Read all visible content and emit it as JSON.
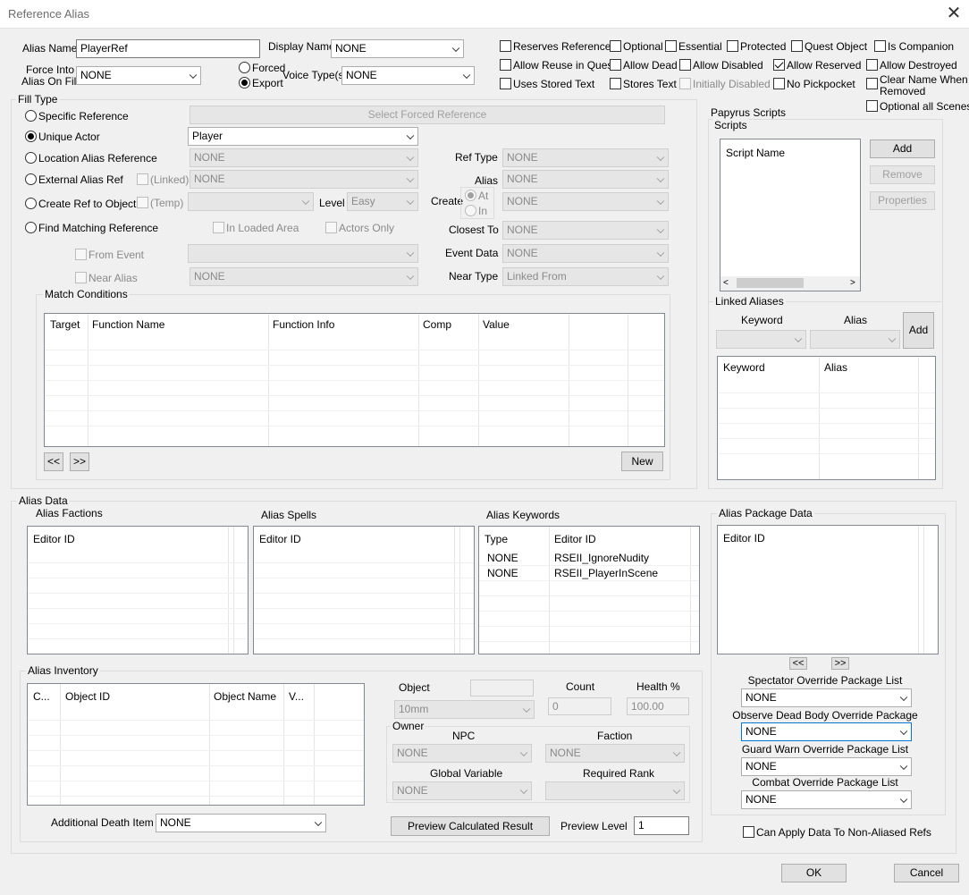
{
  "window": {
    "title": "Reference Alias"
  },
  "top": {
    "alias_name_label": "Alias Name",
    "alias_name_value": "PlayerRef",
    "display_name_label": "Display Name",
    "display_name_value": "NONE",
    "force_into_label_1": "Force Into",
    "force_into_label_2": "Alias On Fill",
    "force_into_value": "NONE",
    "forced_label": "Forced",
    "export_label": "Export",
    "voice_types_label": "Voice Type(s)",
    "voice_types_value": "NONE"
  },
  "flags": {
    "reserves_reference": "Reserves Reference",
    "optional": "Optional",
    "essential": "Essential",
    "protected": "Protected",
    "quest_object": "Quest Object",
    "is_companion": "Is Companion",
    "allow_reuse": "Allow Reuse in Quest",
    "allow_dead": "Allow Dead",
    "allow_disabled": "Allow Disabled",
    "allow_reserved": "Allow Reserved",
    "allow_destroyed": "Allow Destroyed",
    "uses_stored_text": "Uses Stored Text",
    "stores_text": "Stores Text",
    "initially_disabled": "Initially Disabled",
    "no_pickpocket": "No Pickpocket",
    "clear_name_1": "Clear Name When",
    "clear_name_2": "Removed",
    "optional_all_scenes": "Optional all Scenes"
  },
  "fill_type": {
    "group_label": "Fill Type",
    "specific_reference": "Specific Reference",
    "select_forced_reference": "Select Forced Reference",
    "unique_actor": "Unique Actor",
    "unique_actor_value": "Player",
    "location_alias_reference": "Location Alias Reference",
    "location_alias_value": "NONE",
    "ref_type_label": "Ref Type",
    "ref_type_value": "NONE",
    "external_alias_ref": "External Alias Ref",
    "linked_label": "(Linked)",
    "external_alias_value": "NONE",
    "alias_label": "Alias",
    "alias_value": "NONE",
    "create_ref_to_object": "Create Ref to Object",
    "temp_label": "(Temp)",
    "create_ref_value": "",
    "level_label": "Level",
    "level_value": "Easy",
    "create_label": "Create",
    "at_label": "At",
    "in_label": "In",
    "create_value": "NONE",
    "find_matching_reference": "Find Matching Reference",
    "in_loaded_area": "In Loaded Area",
    "actors_only": "Actors Only",
    "closest_to_label": "Closest To",
    "closest_to_value": "NONE",
    "from_event": "From Event",
    "from_event_value": "",
    "event_data_label": "Event Data",
    "event_data_value": "NONE",
    "near_alias": "Near Alias",
    "near_alias_value": "NONE",
    "near_type_label": "Near Type",
    "near_type_value": "Linked From",
    "match_conditions_label": "Match Conditions",
    "columns": [
      "Target",
      "Function Name",
      "Function Info",
      "Comp",
      "Value"
    ],
    "prev_button": "<<",
    "next_button": ">>",
    "new_button": "New"
  },
  "scripts": {
    "group_label": "Papyrus Scripts",
    "sub_label": "Scripts",
    "column": "Script Name",
    "add": "Add",
    "remove": "Remove",
    "properties": "Properties"
  },
  "linked_aliases": {
    "label": "Linked Aliases",
    "keyword_label": "Keyword",
    "alias_label": "Alias",
    "add": "Add",
    "columns": [
      "Keyword",
      "Alias"
    ]
  },
  "alias_data": {
    "label": "Alias Data",
    "factions_label": "Alias Factions",
    "factions_column": "Editor ID",
    "spells_label": "Alias Spells",
    "spells_column": "Editor ID",
    "keywords_label": "Alias Keywords",
    "keywords_columns": [
      "Type",
      "Editor ID"
    ],
    "keywords_rows": [
      {
        "type": "NONE",
        "editor_id": "RSEII_IgnoreNudity"
      },
      {
        "type": "NONE",
        "editor_id": "RSEII_PlayerInScene"
      }
    ],
    "package_label": "Alias Package Data",
    "package_column": "Editor ID",
    "package_prev": "<<",
    "package_next": ">>",
    "spectator_label": "Spectator Override Package List",
    "spectator_value": "NONE",
    "observe_label": "Observe Dead Body Override Package",
    "observe_value": "NONE",
    "guard_label": "Guard Warn Override Package List",
    "guard_value": "NONE",
    "combat_label": "Combat Override Package List",
    "combat_value": "NONE",
    "inventory_label": "Alias Inventory",
    "inventory_columns": [
      "C...",
      "Object ID",
      "Object Name",
      "V..."
    ],
    "object_label": "Object",
    "object_value": "10mm",
    "count_label": "Count",
    "count_value": "0",
    "health_label": "Health %",
    "health_value": "100.00",
    "owner_label": "Owner",
    "npc_label": "NPC",
    "npc_value": "NONE",
    "faction_label": "Faction",
    "faction_value": "NONE",
    "global_var_label": "Global Variable",
    "global_var_value": "NONE",
    "required_rank_label": "Required Rank",
    "required_rank_value": "",
    "additional_death_label": "Additional Death Item",
    "additional_death_value": "NONE",
    "preview_button": "Preview Calculated Result",
    "preview_level_label": "Preview Level",
    "preview_level_value": "1",
    "can_apply_label": "Can Apply Data To Non-Aliased Refs"
  },
  "footer": {
    "ok": "OK",
    "cancel": "Cancel"
  }
}
